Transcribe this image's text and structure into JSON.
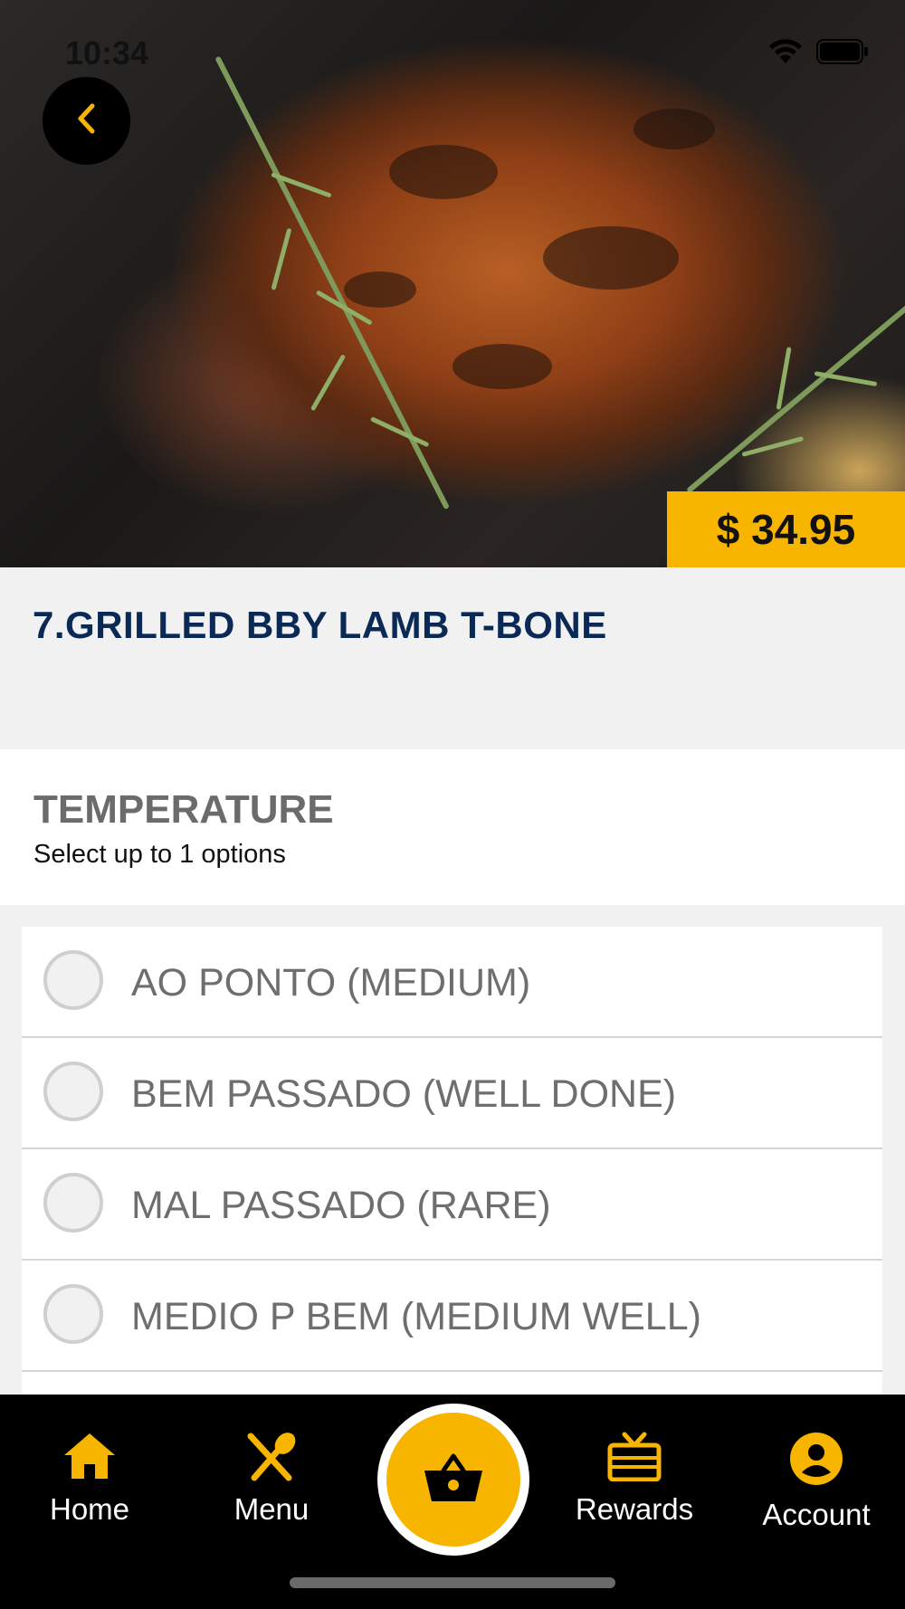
{
  "status_bar": {
    "time": "10:34",
    "wifi_icon": "wifi-icon",
    "battery_icon": "battery-icon"
  },
  "hero": {
    "image": "grilled-lamb-t-bone-photo",
    "back_icon": "chevron-left-icon",
    "price": "$ 34.95"
  },
  "item": {
    "title": "7.GRILLED BBY LAMB T-BONE"
  },
  "section": {
    "title": "TEMPERATURE",
    "subtitle": "Select up to 1 options"
  },
  "options": [
    {
      "label": "AO PONTO (MEDIUM)",
      "selected": false
    },
    {
      "label": "BEM PASSADO (WELL DONE)",
      "selected": false
    },
    {
      "label": "MAL PASSADO (RARE)",
      "selected": false
    },
    {
      "label": "MEDIO P BEM (MEDIUM WELL)",
      "selected": false
    }
  ],
  "nav": {
    "items": [
      {
        "label": "Home",
        "icon": "home-icon"
      },
      {
        "label": "Menu",
        "icon": "utensils-icon"
      },
      {
        "label": "Rewards",
        "icon": "gift-icon"
      },
      {
        "label": "Account",
        "icon": "account-icon"
      }
    ],
    "cart_icon": "basket-icon"
  },
  "colors": {
    "accent": "#f7b500",
    "title": "#0a2a55",
    "nav_bg": "#000000"
  }
}
